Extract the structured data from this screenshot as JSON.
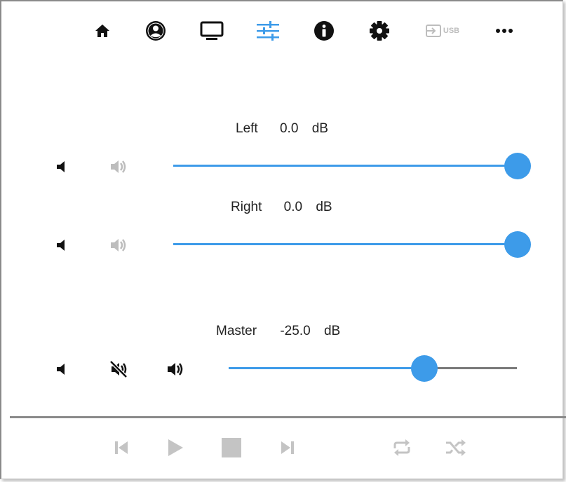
{
  "nav": {
    "items": [
      {
        "id": "home",
        "icon": "home-icon",
        "active": false
      },
      {
        "id": "account",
        "icon": "account-circle-icon",
        "active": false
      },
      {
        "id": "display",
        "icon": "monitor-icon",
        "active": false
      },
      {
        "id": "equalizer",
        "icon": "sliders-icon",
        "active": true
      },
      {
        "id": "info",
        "icon": "info-icon",
        "active": false
      },
      {
        "id": "settings",
        "icon": "gear-icon",
        "active": false
      },
      {
        "id": "input",
        "icon": "input-icon",
        "label": "USB",
        "active": false
      },
      {
        "id": "more",
        "icon": "more-horizontal-icon",
        "active": false
      }
    ],
    "active_color": "#3d9be9",
    "disabled_color": "#bdbdbd"
  },
  "channels": {
    "left": {
      "name": "Left",
      "value": "0.0",
      "unit": "dB",
      "level": 1.0
    },
    "right": {
      "name": "Right",
      "value": "0.0",
      "unit": "dB",
      "level": 1.0
    },
    "master": {
      "name": "Master",
      "value": "-25.0",
      "unit": "dB",
      "level": 0.68
    }
  },
  "transport": {
    "items": [
      "previous-icon",
      "play-icon",
      "stop-icon",
      "next-icon",
      "repeat-icon",
      "shuffle-icon"
    ],
    "color": "#c4c4c4"
  },
  "colors": {
    "accent": "#3d9be9",
    "track": "#7a7a7a",
    "text": "#222222"
  }
}
